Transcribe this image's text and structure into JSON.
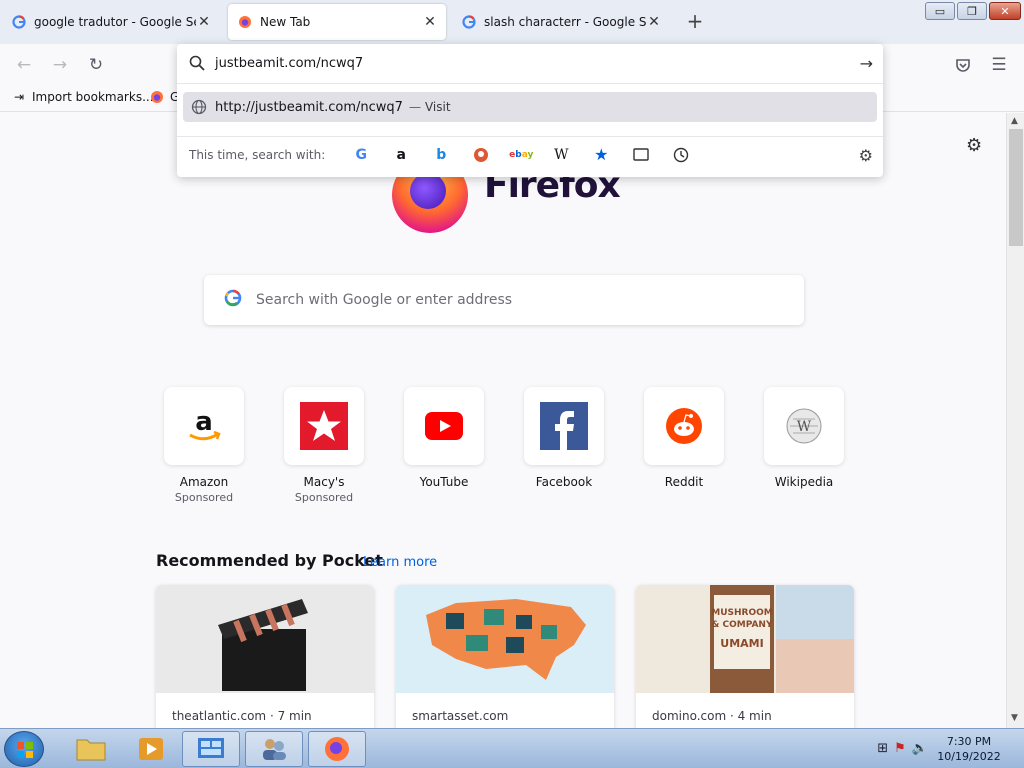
{
  "tabs": [
    {
      "title": "google tradutor - Google Search",
      "favicon": "google-g-icon",
      "active": false
    },
    {
      "title": "New Tab",
      "favicon": "firefox-icon",
      "active": true
    },
    {
      "title": "slash characterr - Google Search",
      "favicon": "google-g-icon",
      "active": false
    }
  ],
  "window_controls": {
    "minimize": "▭",
    "maximize": "❐",
    "close": "✕"
  },
  "bookmarks": {
    "import_label": "Import bookmarks...",
    "second_label": "G"
  },
  "urlbar": {
    "value": "justbeamit.com/ncwq7",
    "result_url": "http://justbeamit.com/ncwq7",
    "result_sep": "—",
    "result_action": "Visit",
    "engines_label": "This time, search with:",
    "engines": [
      "google-icon",
      "amazon-icon",
      "bing-icon",
      "duckduckgo-icon",
      "ebay-icon",
      "wikipedia-icon",
      "bookmarks-star-icon",
      "tabs-icon",
      "history-icon"
    ]
  },
  "newtab": {
    "wordmark": "Firefox",
    "search_placeholder": "Search with Google or enter address",
    "top_sites": [
      {
        "name": "Amazon",
        "sponsored": "Sponsored",
        "icon": "amazon-logo"
      },
      {
        "name": "Macy's",
        "sponsored": "Sponsored",
        "icon": "macys-star-logo"
      },
      {
        "name": "YouTube",
        "sponsored": "",
        "icon": "youtube-logo"
      },
      {
        "name": "Facebook",
        "sponsored": "",
        "icon": "facebook-logo"
      },
      {
        "name": "Reddit",
        "sponsored": "",
        "icon": "reddit-logo"
      },
      {
        "name": "Wikipedia",
        "sponsored": "",
        "icon": "wikipedia-logo"
      }
    ],
    "pocket_heading": "Recommended by Pocket",
    "pocket_learn_more": "Learn more",
    "stories": [
      {
        "source": "theatlantic.com · 7 min"
      },
      {
        "source": "smartasset.com"
      },
      {
        "source": "domino.com · 4 min"
      }
    ]
  },
  "taskbar": {
    "time": "7:30 PM",
    "date": "10/19/2022"
  },
  "colors": {
    "accent": "#0061e0",
    "tabstrip": "#e8edf5",
    "firefox_purple": "#20123a"
  }
}
